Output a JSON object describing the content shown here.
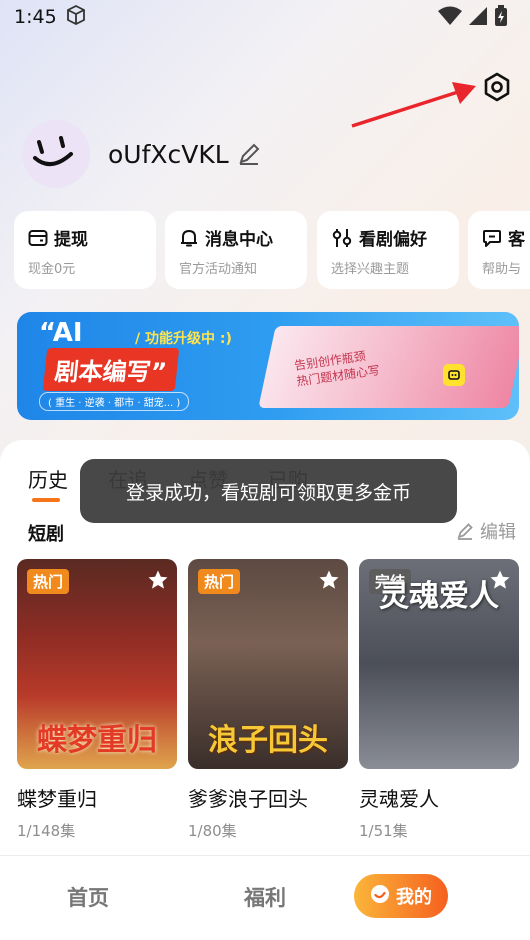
{
  "status_bar": {
    "time": "1:45"
  },
  "profile": {
    "username": "oUfXcVKL"
  },
  "quick_actions": [
    {
      "title": "提现",
      "subtitle": "现金0元"
    },
    {
      "title": "消息中心",
      "subtitle": "官方活动通知"
    },
    {
      "title": "看剧偏好",
      "subtitle": "选择兴趣主题"
    },
    {
      "title": "客",
      "subtitle": "帮助与"
    }
  ],
  "banner": {
    "ai_text": "“AI",
    "tag": "/ 功能升级中 :)",
    "headline": "剧本编写”",
    "sub": "( 重生 · 逆袭 · 都市 · 甜宠... )",
    "book_line1": "告别创作瓶颈",
    "book_line2": "热门题材随心写"
  },
  "tabs": [
    "历史",
    "在追",
    "点赞",
    "已购"
  ],
  "section": {
    "label": "短剧",
    "edit_label": "编辑"
  },
  "dramas": [
    {
      "badge": "热门",
      "badge_color": "#f08a1c",
      "poster_text": "蝶梦重归",
      "title": "蝶梦重归",
      "episodes": "1/148集"
    },
    {
      "badge": "热门",
      "badge_color": "#f08a1c",
      "poster_text": "浪子回头",
      "title": "爹爹浪子回头",
      "episodes": "1/80集"
    },
    {
      "badge": "完结",
      "badge_color": "#5d5d5d",
      "poster_text": "灵魂爱人",
      "title": "灵魂爱人",
      "episodes": "1/51集"
    }
  ],
  "toast": "登录成功，看短剧可领取更多金币",
  "bottom_nav": {
    "home": "首页",
    "welfare": "福利",
    "mine": "我的"
  },
  "colors": {
    "accent": "#f6751b",
    "annotation_arrow": "#e8262b"
  }
}
